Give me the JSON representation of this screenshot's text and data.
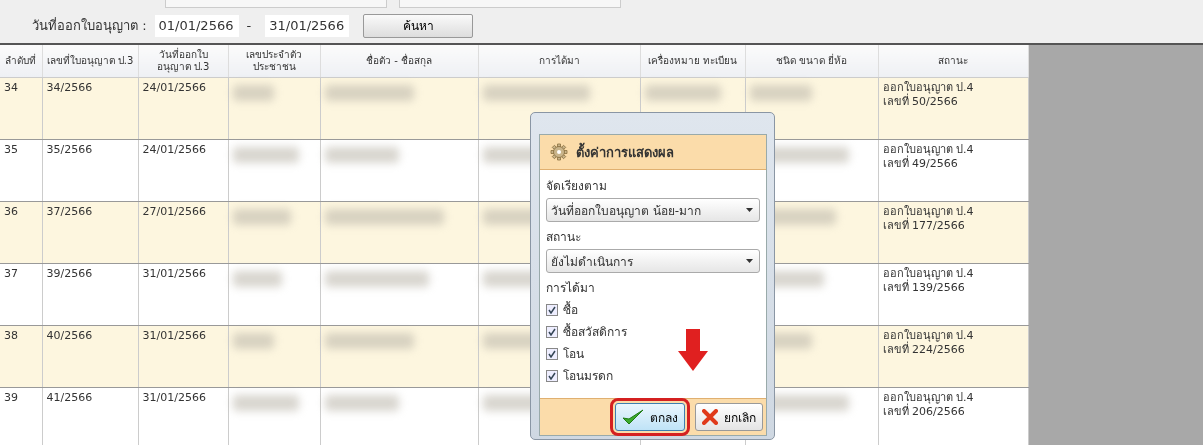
{
  "filter": {
    "date_label": "วันที่ออกใบอนุญาต :",
    "date_from": "01/01/2566",
    "date_separator": "-",
    "date_to": "31/01/2566",
    "search_button": "ค้นหา"
  },
  "table": {
    "columns": [
      "ลำดับที่",
      "เลขที่ใบอนุญาต ป.3",
      "วันที่ออกใบ อนุญาต ป.3",
      "เลขประจำตัว ประชาชน",
      "ชื่อตัว - ชื่อสกุล",
      "การได้มา",
      "เครื่องหมาย ทะเบียน",
      "ชนิด ขนาด ยี่ห้อ",
      "สถานะ"
    ],
    "rows": [
      {
        "no": "34",
        "permit": "34/2566",
        "date": "24/01/2566",
        "status": "ออกใบอนุญาต ป.4\nเลขที่ 50/2566"
      },
      {
        "no": "35",
        "permit": "35/2566",
        "date": "24/01/2566",
        "status": "ออกใบอนุญาต ป.4\nเลขที่ 49/2566"
      },
      {
        "no": "36",
        "permit": "37/2566",
        "date": "27/01/2566",
        "status": "ออกใบอนุญาต ป.4\nเลขที่ 177/2566"
      },
      {
        "no": "37",
        "permit": "39/2566",
        "date": "31/01/2566",
        "status": "ออกใบอนุญาต ป.4\nเลขที่ 139/2566"
      },
      {
        "no": "38",
        "permit": "40/2566",
        "date": "31/01/2566",
        "status": "ออกใบอนุญาต ป.4\nเลขที่ 224/2566"
      },
      {
        "no": "39",
        "permit": "41/2566",
        "date": "31/01/2566",
        "status": "ออกใบอนุญาต ป.4\nเลขที่ 206/2566"
      }
    ]
  },
  "dialog": {
    "title": "ตั้งค่าการแสดงผล",
    "sort_label": "จัดเรียงตาม",
    "sort_value": "วันที่ออกใบอนุญาต น้อย-มาก",
    "status_label": "สถานะ",
    "status_value": "ยังไม่ดำเนินการ",
    "acquisition_label": "การได้มา",
    "options": [
      {
        "label": "ซื้อ",
        "checked": true
      },
      {
        "label": "ซื้อสวัสดิการ",
        "checked": true
      },
      {
        "label": "โอน",
        "checked": true
      },
      {
        "label": "โอนมรดก",
        "checked": true
      }
    ],
    "buttons": [
      {
        "kind": "ok",
        "label": "ตกลง",
        "highlighted": true
      },
      {
        "kind": "cancel",
        "label": "ยกเลิก",
        "highlighted": false
      }
    ]
  }
}
